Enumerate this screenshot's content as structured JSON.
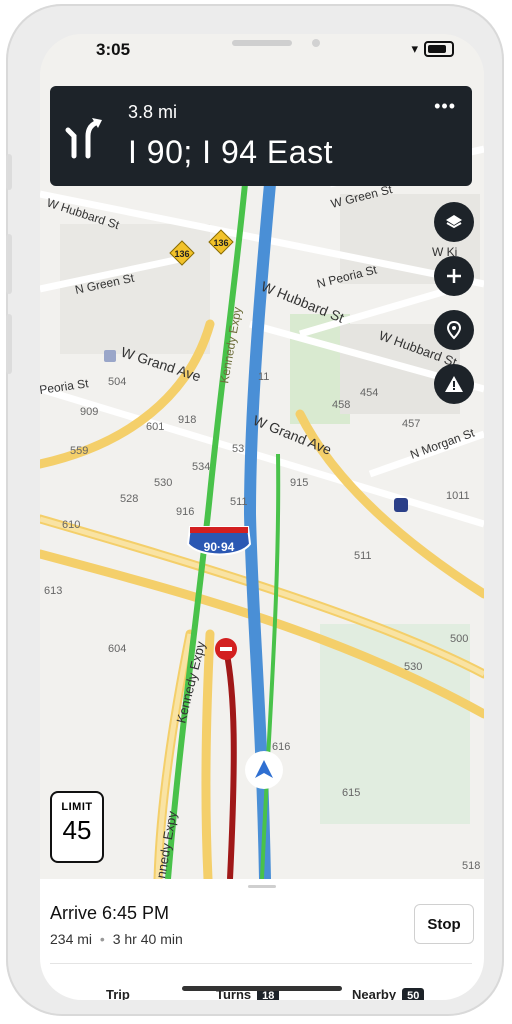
{
  "status_bar": {
    "time": "3:05"
  },
  "navigation": {
    "distance": "3.8 mi",
    "road": "I 90; I 94 East",
    "more_label": "•••"
  },
  "map": {
    "street_labels": [
      "W Hubbard St",
      "N Green St",
      "W Grand Ave",
      "Peoria St",
      "W Hubbard St",
      "N Peoria St",
      "W Hubbard St",
      "W Grand Ave",
      "N Morgan St",
      "W Green St",
      "W Ki",
      "Kennedy Expy",
      "Kennedy Expy",
      "nnedy Expy"
    ],
    "numbers": [
      "504",
      "909",
      "559",
      "601",
      "918",
      "534",
      "530",
      "528",
      "916",
      "53",
      "511",
      "915",
      "610",
      "613",
      "604",
      "511",
      "500",
      "530",
      "616",
      "615",
      "518",
      "454",
      "458",
      "457",
      "1011",
      "11"
    ],
    "shields": {
      "route_136": "136",
      "interstate": "90·94"
    }
  },
  "controls": {
    "layers_icon": "layers-icon",
    "add_icon": "plus-icon",
    "pin_icon": "location-pin-icon",
    "alert_icon": "warning-icon"
  },
  "speed_limit": {
    "label": "LIMIT",
    "value": "45"
  },
  "trip": {
    "arrive": "Arrive 6:45 PM",
    "distance": "234 mi",
    "separator": "•",
    "duration": "3 hr 40 min",
    "stop_label": "Stop"
  },
  "tabs": [
    {
      "label": "Trip",
      "badge": ""
    },
    {
      "label": "Turns",
      "badge": "18"
    },
    {
      "label": "Nearby",
      "badge": "50"
    }
  ],
  "colors": {
    "banner": "#1d2329",
    "route_blue": "#4a8fd6",
    "traffic_green": "#49c24a",
    "traffic_red": "#a01818",
    "highway": "#f7d67a"
  }
}
